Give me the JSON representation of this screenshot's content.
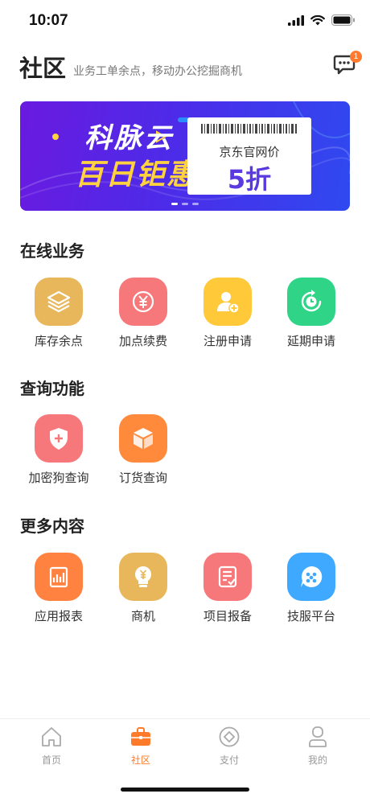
{
  "status_bar": {
    "time": "10:07"
  },
  "header": {
    "title": "社区",
    "subtitle": "业务工单余点，移动办公挖掘商机",
    "message_badge": "1"
  },
  "banner": {
    "brand": "科脉云",
    "headline": "百日钜惠",
    "ticket_store": "京东官网价",
    "ticket_discount": "5折"
  },
  "sections": {
    "online": {
      "title": "在线业务",
      "items": [
        {
          "label": "库存余点",
          "icon": "layers-icon",
          "color": "#e8b75c"
        },
        {
          "label": "加点续费",
          "icon": "yuan-coin-icon",
          "color": "#f7787a"
        },
        {
          "label": "注册申请",
          "icon": "add-user-icon",
          "color": "#ffc93a"
        },
        {
          "label": "延期申请",
          "icon": "clock-refresh-icon",
          "color": "#2fd487"
        }
      ]
    },
    "query": {
      "title": "查询功能",
      "items": [
        {
          "label": "加密狗查询",
          "icon": "shield-plus-icon",
          "color": "#f7787a"
        },
        {
          "label": "订货查询",
          "icon": "box-icon",
          "color": "#ff8a3c"
        }
      ]
    },
    "more": {
      "title": "更多内容",
      "items": [
        {
          "label": "应用报表",
          "icon": "chart-doc-icon",
          "color": "#ff8240"
        },
        {
          "label": "商机",
          "icon": "yuan-bulb-icon",
          "color": "#e8b75c"
        },
        {
          "label": "项目报备",
          "icon": "checklist-icon",
          "color": "#f7787a"
        },
        {
          "label": "技服平台",
          "icon": "support-chat-icon",
          "color": "#3fa9ff"
        }
      ]
    }
  },
  "tab_bar": {
    "items": [
      {
        "label": "首页",
        "icon": "home-icon"
      },
      {
        "label": "社区",
        "icon": "briefcase-icon",
        "active": true
      },
      {
        "label": "支付",
        "icon": "pay-coin-icon"
      },
      {
        "label": "我的",
        "icon": "user-icon"
      }
    ]
  },
  "colors": {
    "accent": "#ff7a2a"
  }
}
